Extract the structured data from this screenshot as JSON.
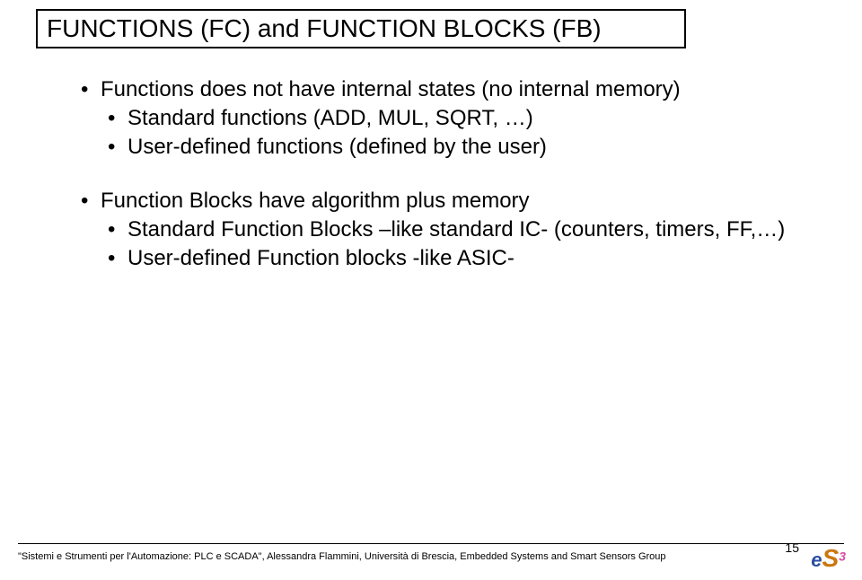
{
  "title": "FUNCTIONS (FC) and FUNCTION BLOCKS (FB)",
  "bullets": {
    "b1": "Functions does not have internal states (no internal memory)",
    "b1s1": "Standard functions (ADD, MUL, SQRT, …)",
    "b1s2": "User-defined functions (defined by the user)",
    "b2": "Function Blocks have algorithm plus memory",
    "b2s1": "Standard Function Blocks –like standard IC- (counters, timers, FF,…)",
    "b2s2": "User-defined Function blocks  -like ASIC-"
  },
  "footer": "\"Sistemi e Strumenti per l'Automazione: PLC e SCADA\", Alessandra Flammini, Università di Brescia, Embedded Systems and Smart Sensors Group",
  "pageNumber": "15",
  "logo": {
    "e": "e",
    "s": "S",
    "three": "3"
  }
}
